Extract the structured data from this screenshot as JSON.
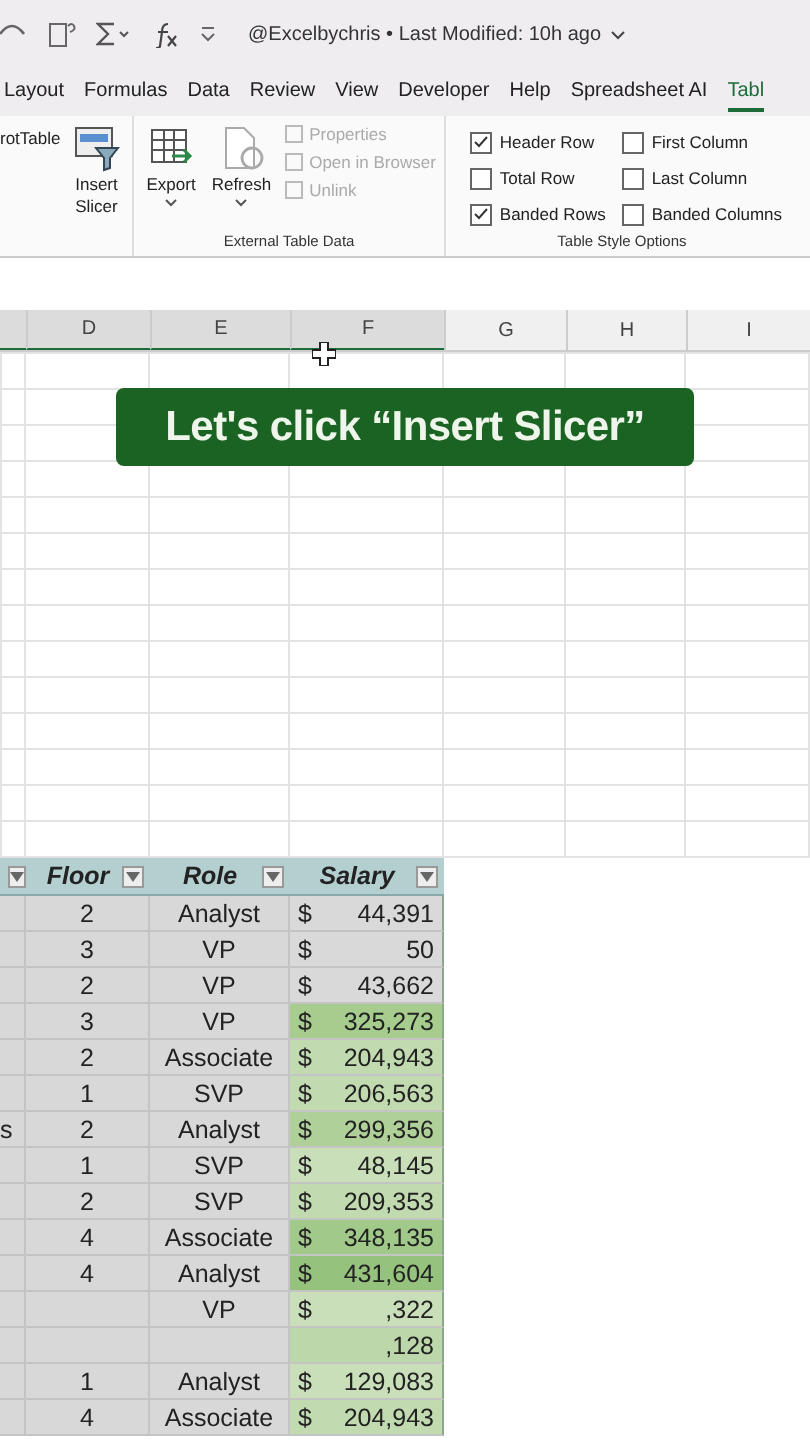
{
  "title_bar": {
    "file_info": "@Excelbychris • Last Modified: 10h ago"
  },
  "tabs": [
    {
      "label": "Layout",
      "selected": false
    },
    {
      "label": "Formulas",
      "selected": false
    },
    {
      "label": "Data",
      "selected": false
    },
    {
      "label": "Review",
      "selected": false
    },
    {
      "label": "View",
      "selected": false
    },
    {
      "label": "Developer",
      "selected": false
    },
    {
      "label": "Help",
      "selected": false
    },
    {
      "label": "Spreadsheet AI",
      "selected": false
    },
    {
      "label": "Tabl",
      "selected": true
    }
  ],
  "ribbon": {
    "cut_label": "rotTable",
    "insert_slicer": "Insert\nSlicer",
    "external": {
      "buttons": [
        {
          "label": "Export",
          "kind": "export"
        },
        {
          "label": "Refresh",
          "kind": "refresh"
        }
      ],
      "links": [
        {
          "label": "Properties",
          "disabled": true
        },
        {
          "label": "Open in Browser",
          "disabled": true
        },
        {
          "label": "Unlink",
          "disabled": true
        }
      ],
      "group_label": "External Table Data"
    },
    "style_options": {
      "options": [
        {
          "label": "Header Row",
          "checked": true
        },
        {
          "label": "Total Row",
          "checked": false
        },
        {
          "label": "Banded Rows",
          "checked": true
        },
        {
          "label": "First Column",
          "checked": false
        },
        {
          "label": "Last Column",
          "checked": false
        },
        {
          "label": "Banded Columns",
          "checked": false
        }
      ],
      "group_label": "Table Style Options"
    }
  },
  "column_headers": [
    {
      "label": "D",
      "selected": true
    },
    {
      "label": "E",
      "selected": true
    },
    {
      "label": "F",
      "selected": true
    },
    {
      "label": "G",
      "selected": false
    },
    {
      "label": "H",
      "selected": false
    },
    {
      "label": "I",
      "selected": false
    }
  ],
  "callout": "Let's click “Insert Slicer”",
  "table": {
    "columns": [
      "Floor",
      "Role",
      "Salary"
    ],
    "rows": [
      {
        "floor": "2",
        "role": "Analyst",
        "currency": "$",
        "salary": "44,391",
        "color": "#d9d9d9"
      },
      {
        "floor": "3",
        "role": "VP",
        "currency": "$",
        "salary": "50",
        "color": "#d9d9d9"
      },
      {
        "floor": "2",
        "role": "VP",
        "currency": "$",
        "salary": "43,662",
        "color": "#d9d9d9"
      },
      {
        "floor": "3",
        "role": "VP",
        "currency": "$",
        "salary": "325,273",
        "color": "#a6cc8e"
      },
      {
        "floor": "2",
        "role": "Associate",
        "currency": "$",
        "salary": "204,943",
        "color": "#c2dab0"
      },
      {
        "floor": "1",
        "role": "SVP",
        "currency": "$",
        "salary": "206,563",
        "color": "#c2dab0"
      },
      {
        "column_1": "s",
        "floor": "2",
        "role": "Analyst",
        "currency": "$",
        "salary": "299,356",
        "color": "#afd199"
      },
      {
        "floor": "1",
        "role": "SVP",
        "currency": "$",
        "salary": "48,145",
        "color": "#c9dfb9"
      },
      {
        "floor": "2",
        "role": "SVP",
        "currency": "$",
        "salary": "209,353",
        "color": "#c2dab0"
      },
      {
        "floor": "4",
        "role": "Associate",
        "currency": "$",
        "salary": "348,135",
        "color": "#a1c98a"
      },
      {
        "floor": "4",
        "role": "Analyst",
        "currency": "$",
        "salary": "431,604",
        "color": "#95c27c"
      },
      {
        "role": "VP",
        "currency": "$",
        "salary": ",322",
        "color": "#c9dfb9"
      },
      {
        "salary": ",128",
        "color": "#bcd7a9"
      },
      {
        "floor": "1",
        "role": "Analyst",
        "currency": "$",
        "salary": "129,083",
        "color": "#c9dfb9"
      },
      {
        "floor": "4",
        "role": "Associate",
        "currency": "$",
        "salary": "204,943",
        "color": "#c2dab0"
      }
    ]
  }
}
